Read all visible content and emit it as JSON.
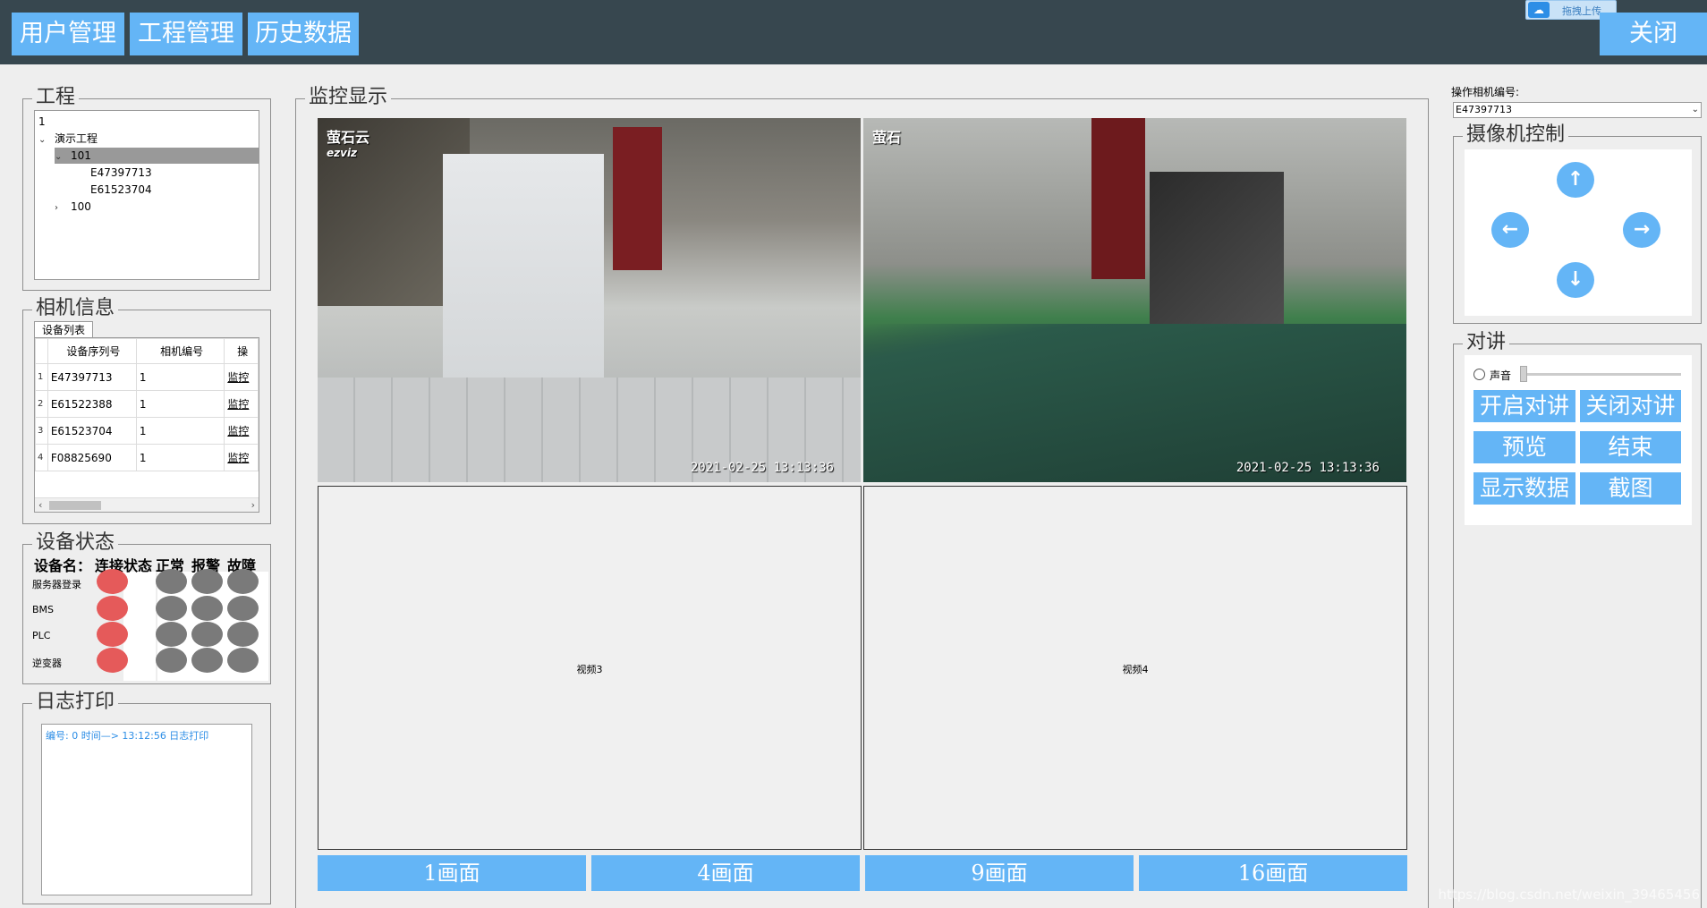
{
  "nav": {
    "user_mgmt": "用户管理",
    "project_mgmt": "工程管理",
    "history": "历史数据",
    "close": "关闭"
  },
  "upload_badge": "拖拽上传",
  "project": {
    "title": "工程",
    "root": "1",
    "demo": "演示工程",
    "node_101": "101",
    "cam1": "E47397713",
    "cam2": "E61523704",
    "node_100": "100"
  },
  "camera_info": {
    "title": "相机信息",
    "tab": "设备列表",
    "headers": [
      "设备序列号",
      "相机编号",
      "操"
    ],
    "rows": [
      {
        "n": "1",
        "serial": "E47397713",
        "cam": "1",
        "op": "监控"
      },
      {
        "n": "2",
        "serial": "E61522388",
        "cam": "1",
        "op": "监控"
      },
      {
        "n": "3",
        "serial": "E61523704",
        "cam": "1",
        "op": "监控"
      },
      {
        "n": "4",
        "serial": "F08825690",
        "cam": "1",
        "op": "监控"
      }
    ]
  },
  "device_status": {
    "title": "设备状态",
    "head_name": "设备名：",
    "head_conn": "连接状态",
    "head_normal": "正常",
    "head_alarm": "报警",
    "head_fault": "故障",
    "names": [
      "服务器登录",
      "BMS",
      "PLC",
      "逆变器"
    ]
  },
  "log": {
    "title": "日志打印",
    "line": "编号: 0 时间—> 13:12:56 日志打印"
  },
  "monitor": {
    "title": "监控显示",
    "v1_ts": "2021-02-25 13:13:36",
    "v2_ts": "2021-02-25 13:13:36",
    "brand1_cn": "萤石云",
    "brand1_en": "ezviz",
    "brand2": "萤石",
    "v3": "视频3",
    "v4": "视频4",
    "layouts": [
      "1画面",
      "4画面",
      "9画面",
      "16画面"
    ]
  },
  "right": {
    "cam_label": "操作相机编号:",
    "cam_value": "E47397713",
    "ptz_title": "摄像机控制",
    "talk_title": "对讲",
    "sound": "声音",
    "start_talk": "开启对讲",
    "stop_talk": "关闭对讲",
    "preview": "预览",
    "end": "结束",
    "show_data": "显示数据",
    "screenshot": "截图"
  },
  "watermark": "https://blog.csdn.net/weixin_39465456"
}
